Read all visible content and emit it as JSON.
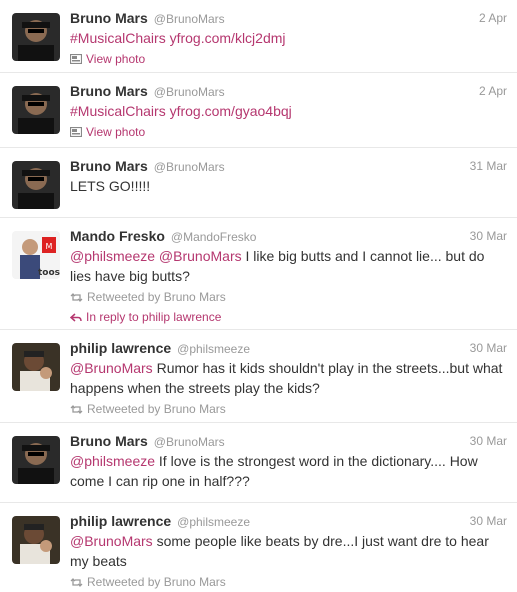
{
  "tweets": [
    {
      "author": "Bruno Mars",
      "handle": "@BrunoMars",
      "date": "2 Apr",
      "avatar_icon": "bruno-mars-avatar",
      "body": [
        {
          "t": "#MusicalChairs yfrog.com/klcj2dmj",
          "link": true
        }
      ],
      "action": "View photo",
      "action_icon": "photo-icon"
    },
    {
      "author": "Bruno Mars",
      "handle": "@BrunoMars",
      "date": "2 Apr",
      "avatar_icon": "bruno-mars-avatar",
      "body": [
        {
          "t": "#MusicalChairs yfrog.com/gyao4bqj",
          "link": true
        }
      ],
      "action": "View photo",
      "action_icon": "photo-icon"
    },
    {
      "author": "Bruno Mars",
      "handle": "@BrunoMars",
      "date": "31 Mar",
      "avatar_icon": "bruno-mars-avatar",
      "body": [
        {
          "t": "LETS GO!!!!!",
          "link": false
        }
      ]
    },
    {
      "author": "Mando Fresko",
      "handle": "@MandoFresko",
      "date": "30 Mar",
      "avatar_icon": "mando-fresko-avatar",
      "body": [
        {
          "t": "@philsmeeze",
          "link": true
        },
        {
          "t": " ",
          "link": false
        },
        {
          "t": "@BrunoMars",
          "link": true
        },
        {
          "t": " I like big butts and I cannot lie... but do lies have big butts?",
          "link": false
        }
      ],
      "retweeted_by": "Retweeted by Bruno Mars",
      "reply_to": "In reply to philip lawrence"
    },
    {
      "author": "philip lawrence",
      "handle": "@philsmeeze",
      "date": "30 Mar",
      "avatar_icon": "philip-lawrence-avatar",
      "body": [
        {
          "t": "@BrunoMars",
          "link": true
        },
        {
          "t": " Rumor has it kids shouldn't play in the streets...but what happens when the streets play the kids?",
          "link": false
        }
      ],
      "retweeted_by": "Retweeted by Bruno Mars"
    },
    {
      "author": "Bruno Mars",
      "handle": "@BrunoMars",
      "date": "30 Mar",
      "avatar_icon": "bruno-mars-avatar",
      "body": [
        {
          "t": "@philsmeeze",
          "link": true
        },
        {
          "t": " If love is the strongest word in the dictionary.... How come I can rip one in half???",
          "link": false
        }
      ]
    },
    {
      "author": "philip lawrence",
      "handle": "@philsmeeze",
      "date": "30 Mar",
      "avatar_icon": "philip-lawrence-avatar",
      "body": [
        {
          "t": "@BrunoMars",
          "link": true
        },
        {
          "t": " some people like beats by dre...I just want dre to hear my beats",
          "link": false
        }
      ],
      "retweeted_by": "Retweeted by Bruno Mars"
    }
  ],
  "colors": {
    "link": "#b5376f",
    "muted": "#999999",
    "text": "#333333",
    "divider": "#e8e8e8"
  }
}
